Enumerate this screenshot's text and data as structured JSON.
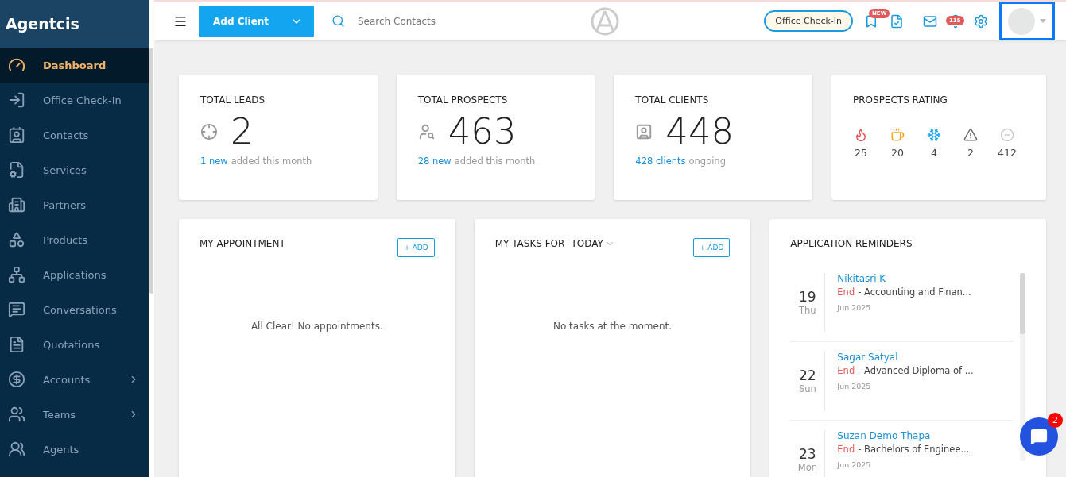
{
  "brand": "Agentcis",
  "sidebar": {
    "items": [
      {
        "label": "Dashboard",
        "kind": "dashboard",
        "selected": true,
        "submenu": false
      },
      {
        "label": "Office Check-In",
        "kind": "checkin",
        "selected": false,
        "submenu": false
      },
      {
        "label": "Contacts",
        "kind": "contacts",
        "selected": false,
        "submenu": false
      },
      {
        "label": "Services",
        "kind": "services",
        "selected": false,
        "submenu": false
      },
      {
        "label": "Partners",
        "kind": "partners",
        "selected": false,
        "submenu": false
      },
      {
        "label": "Products",
        "kind": "products",
        "selected": false,
        "submenu": false
      },
      {
        "label": "Applications",
        "kind": "applications",
        "selected": false,
        "submenu": false
      },
      {
        "label": "Conversations",
        "kind": "conversations",
        "selected": false,
        "submenu": false
      },
      {
        "label": "Quotations",
        "kind": "quotations",
        "selected": false,
        "submenu": false
      },
      {
        "label": "Accounts",
        "kind": "accounts",
        "selected": false,
        "submenu": true
      },
      {
        "label": "Teams",
        "kind": "teams",
        "selected": false,
        "submenu": true
      },
      {
        "label": "Agents",
        "kind": "agents",
        "selected": false,
        "submenu": false
      }
    ]
  },
  "header": {
    "add_button": "Add Client",
    "search": {
      "placeholder": "Search Contacts"
    },
    "checkin_button": "Office Check-In",
    "new_badge": "NEW",
    "notification_count": "115"
  },
  "stats": [
    {
      "kind": "leads",
      "title": "TOTAL LEADS",
      "value": "2",
      "highlight": "1 new",
      "rest": "added this month"
    },
    {
      "kind": "prospects",
      "title": "TOTAL PROSPECTS",
      "value": "463",
      "highlight": "28 new",
      "rest": "added this month"
    },
    {
      "kind": "clients",
      "title": "TOTAL CLIENTS",
      "value": "448",
      "highlight": "428 clients",
      "rest": "ongoing"
    }
  ],
  "rating": {
    "title": "PROSPECTS RATING",
    "items": [
      {
        "kind": "hot",
        "count": "25"
      },
      {
        "kind": "warm",
        "count": "20"
      },
      {
        "kind": "cold",
        "count": "4"
      },
      {
        "kind": "warning",
        "count": "2"
      },
      {
        "kind": "none",
        "count": "412"
      }
    ]
  },
  "appointments": {
    "title": "MY APPOINTMENT",
    "add_button": "+ ADD",
    "empty": "All Clear! No appointments."
  },
  "tasks": {
    "title": "MY TASKS FOR",
    "filter": "TODAY",
    "add_button": "+ ADD",
    "empty": "No tasks at the moment."
  },
  "reminders": {
    "title": "APPLICATION REMINDERS",
    "items": [
      {
        "day": "19",
        "weekday": "Thu",
        "name": "Nikitasri K",
        "status": "End",
        "detail": "- Accounting and Finan...",
        "month": "Jun 2025"
      },
      {
        "day": "22",
        "weekday": "Sun",
        "name": "Sagar Satyal",
        "status": "End",
        "detail": "- Advanced Diploma of ...",
        "month": "Jun 2025"
      },
      {
        "day": "23",
        "weekday": "Mon",
        "name": "Suzan Demo Thapa",
        "status": "End",
        "detail": "- Bachelors of Enginee...",
        "month": "Jun 2025"
      }
    ]
  },
  "chat_badge": "2"
}
